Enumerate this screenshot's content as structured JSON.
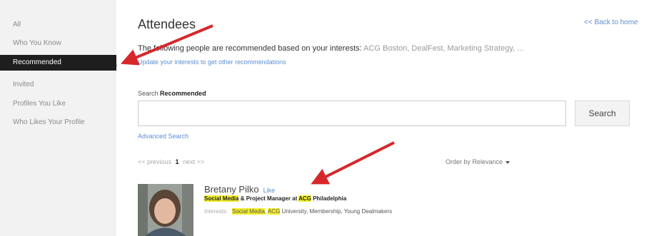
{
  "sidebar": {
    "items": [
      {
        "label": "All",
        "active": false
      },
      {
        "label": "Who You Know",
        "active": false
      },
      {
        "label": "Recommended",
        "active": true
      },
      {
        "label": "Invited",
        "active": false
      },
      {
        "label": "Profiles You Like",
        "active": false
      },
      {
        "label": "Who Likes Your Profile",
        "active": false
      }
    ]
  },
  "header": {
    "title": "Attendees",
    "back_link": "<< Back to home"
  },
  "recommendation": {
    "intro": "The following people are recommended based on your interests: ",
    "interests": "ACG Boston, DealFest, Marketing Strategy, ...",
    "update_link": "Update your interests to get other recommendations"
  },
  "search": {
    "label_prefix": "Search",
    "label_bold": "Recommended",
    "input_value": "",
    "placeholder": "",
    "button_label": "Search",
    "advanced_link": "Advanced Search"
  },
  "pagination": {
    "previous": "<< previous",
    "current_page": "1",
    "next": "next >>"
  },
  "sort": {
    "label": "Order by Relevance"
  },
  "results": [
    {
      "name": "Bretany Pilko",
      "like": "Like",
      "headline_parts": [
        "Social Media",
        " & Project Manager at ",
        "ACG",
        " Philadelphia"
      ],
      "interests_label": "Interests:",
      "interests_hl1": "Social Media",
      "interests_hl2": "ACG",
      "interests_rest": " University, Membership, Young Dealmakers"
    }
  ],
  "colors": {
    "accent_link": "#5b8ed1",
    "highlight": "#f3ef2b",
    "annotation_arrow": "#d6282b",
    "sidebar_active": "#1e1e1e"
  }
}
